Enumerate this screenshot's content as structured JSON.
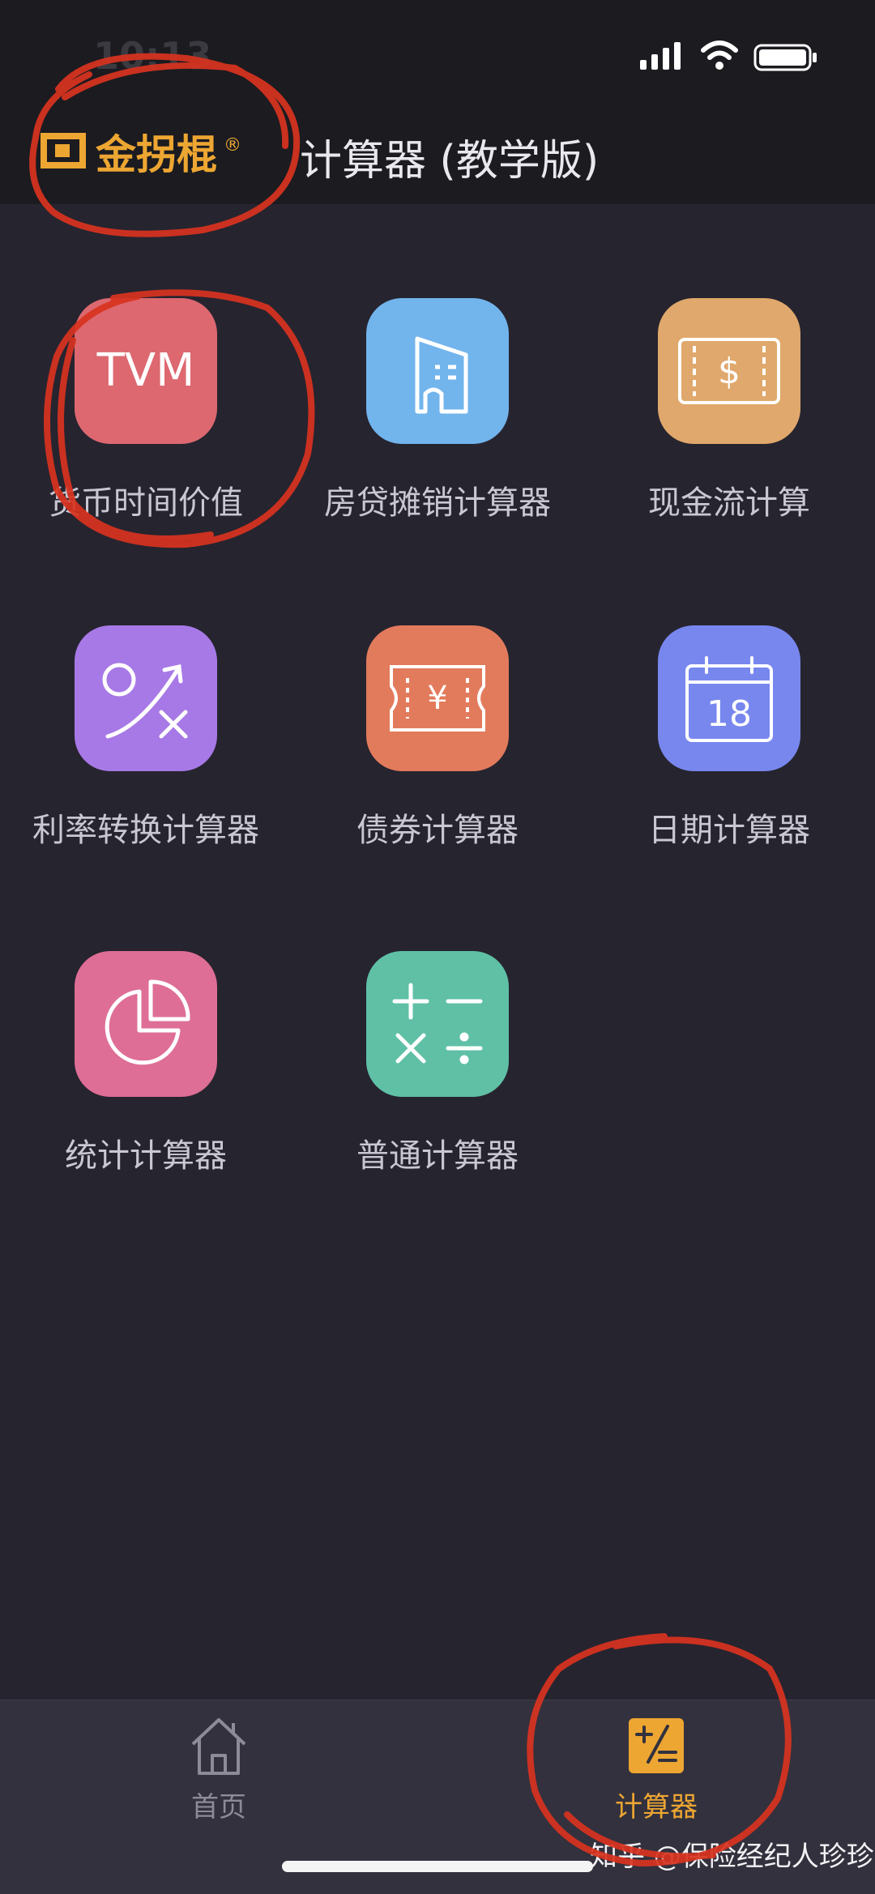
{
  "status_bar": {
    "time": "10:13"
  },
  "header": {
    "logo_text": "金拐棍",
    "logo_mark": "®",
    "title": "计算器 (教学版)"
  },
  "calculators": [
    {
      "label": "货币时间价值",
      "icon": "tvm-icon",
      "icon_text": "TVM",
      "color": "#dd6870"
    },
    {
      "label": "房贷摊销计算器",
      "icon": "building-icon",
      "color": "#72b4ec"
    },
    {
      "label": "现金流计算",
      "icon": "cash-flow-icon",
      "icon_text": "$",
      "color": "#e0a86c"
    },
    {
      "label": "利率转换计算器",
      "icon": "rate-convert-icon",
      "color": "#a779e6"
    },
    {
      "label": "债券计算器",
      "icon": "bond-ticket-icon",
      "icon_text": "¥",
      "color": "#e27b5c"
    },
    {
      "label": "日期计算器",
      "icon": "calendar-icon",
      "icon_text": "18",
      "color": "#7887ee"
    },
    {
      "label": "统计计算器",
      "icon": "pie-chart-icon",
      "color": "#de6e96"
    },
    {
      "label": "普通计算器",
      "icon": "arithmetic-icon",
      "color": "#5fc0a6"
    }
  ],
  "tabbar": {
    "tabs": [
      {
        "label": "首页",
        "icon": "home-icon",
        "active": false
      },
      {
        "label": "计算器",
        "icon": "calculator-tab-icon",
        "active": true
      }
    ],
    "active_color": "#eda632",
    "inactive_color": "#8e8b98"
  },
  "watermark": "知乎 @保险经纪人珍珍"
}
